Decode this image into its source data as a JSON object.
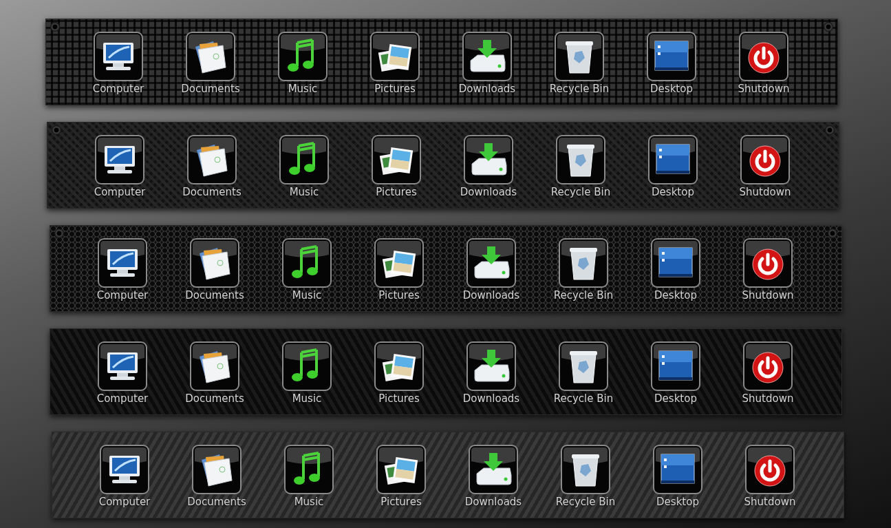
{
  "docks": [
    {
      "kind": "weave",
      "screws": true,
      "items": [
        {
          "kind": "computer",
          "label": "Computer"
        },
        {
          "kind": "documents",
          "label": "Documents"
        },
        {
          "kind": "music",
          "label": "Music"
        },
        {
          "kind": "pictures",
          "label": "Pictures"
        },
        {
          "kind": "downloads",
          "label": "Downloads"
        },
        {
          "kind": "recycle",
          "label": "Recycle Bin"
        },
        {
          "kind": "desktop",
          "label": "Desktop"
        },
        {
          "kind": "shutdown",
          "label": "Shutdown"
        }
      ]
    },
    {
      "kind": "carbon",
      "screws": true,
      "items": [
        {
          "kind": "computer",
          "label": "Computer"
        },
        {
          "kind": "documents",
          "label": "Documents"
        },
        {
          "kind": "music",
          "label": "Music"
        },
        {
          "kind": "pictures",
          "label": "Pictures"
        },
        {
          "kind": "downloads",
          "label": "Downloads"
        },
        {
          "kind": "recycle",
          "label": "Recycle Bin"
        },
        {
          "kind": "desktop",
          "label": "Desktop"
        },
        {
          "kind": "shutdown",
          "label": "Shutdown"
        }
      ]
    },
    {
      "kind": "hex",
      "screws": true,
      "items": [
        {
          "kind": "computer",
          "label": "Computer"
        },
        {
          "kind": "documents",
          "label": "Documents"
        },
        {
          "kind": "music",
          "label": "Music"
        },
        {
          "kind": "pictures",
          "label": "Pictures"
        },
        {
          "kind": "downloads",
          "label": "Downloads"
        },
        {
          "kind": "recycle",
          "label": "Recycle Bin"
        },
        {
          "kind": "desktop",
          "label": "Desktop"
        },
        {
          "kind": "shutdown",
          "label": "Shutdown"
        }
      ]
    },
    {
      "kind": "twill",
      "screws": false,
      "items": [
        {
          "kind": "computer",
          "label": "Computer"
        },
        {
          "kind": "documents",
          "label": "Documents"
        },
        {
          "kind": "music",
          "label": "Music"
        },
        {
          "kind": "pictures",
          "label": "Pictures"
        },
        {
          "kind": "downloads",
          "label": "Downloads"
        },
        {
          "kind": "recycle",
          "label": "Recycle Bin"
        },
        {
          "kind": "desktop",
          "label": "Desktop"
        },
        {
          "kind": "shutdown",
          "label": "Shutdown"
        }
      ]
    },
    {
      "kind": "diagonal",
      "screws": false,
      "items": [
        {
          "kind": "computer",
          "label": "Computer"
        },
        {
          "kind": "documents",
          "label": "Documents"
        },
        {
          "kind": "music",
          "label": "Music"
        },
        {
          "kind": "pictures",
          "label": "Pictures"
        },
        {
          "kind": "downloads",
          "label": "Downloads"
        },
        {
          "kind": "recycle",
          "label": "Recycle Bin"
        },
        {
          "kind": "desktop",
          "label": "Desktop"
        },
        {
          "kind": "shutdown",
          "label": "Shutdown"
        }
      ]
    }
  ]
}
